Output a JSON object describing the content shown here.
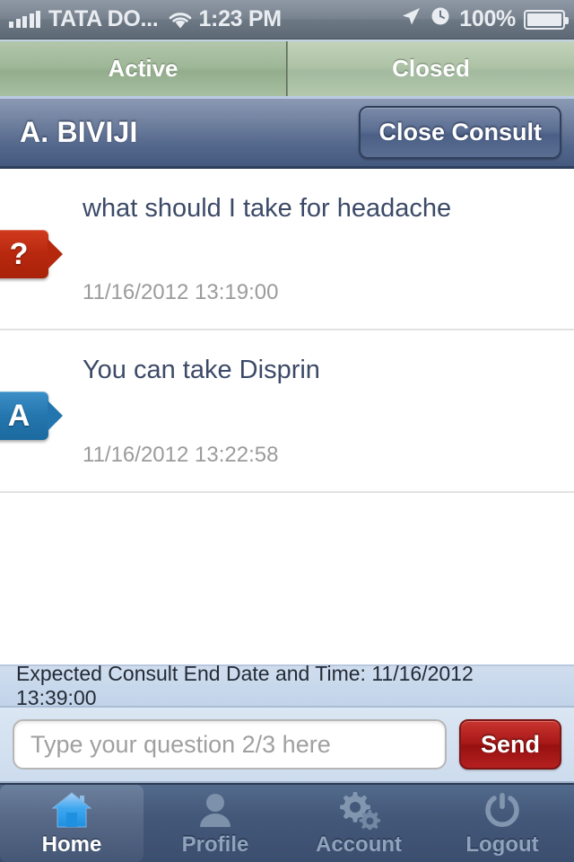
{
  "statusbar": {
    "signal_icon": "signal-bars-icon",
    "carrier": "TATA DO...",
    "wifi_icon": "wifi-icon",
    "time": "1:23 PM",
    "location_icon": "location-arrow-icon",
    "alarm_icon": "alarm-clock-icon",
    "battery_percent": "100%",
    "battery_icon": "battery-charging-icon"
  },
  "segmented": {
    "tabs": [
      {
        "label": "Active",
        "selected": true
      },
      {
        "label": "Closed",
        "selected": false
      }
    ]
  },
  "header": {
    "title": "A. BIVIJI",
    "close_button": "Close Consult"
  },
  "messages": [
    {
      "badge": "?",
      "badge_type": "question",
      "text": "what should I take for headache",
      "timestamp": "11/16/2012 13:19:00"
    },
    {
      "badge": "A",
      "badge_type": "answer",
      "text": "You can take Disprin",
      "timestamp": "11/16/2012 13:22:58"
    }
  ],
  "expected": {
    "text": "Expected Consult End Date and Time: 11/16/2012 13:39:00"
  },
  "composer": {
    "input_value": "",
    "input_placeholder": "Type your question 2/3 here",
    "send_label": "Send"
  },
  "tabbar": {
    "items": [
      {
        "label": "Home",
        "icon": "home-icon",
        "active": true
      },
      {
        "label": "Profile",
        "icon": "person-icon",
        "active": false
      },
      {
        "label": "Account",
        "icon": "gears-icon",
        "active": false
      },
      {
        "label": "Logout",
        "icon": "power-icon",
        "active": false
      }
    ]
  },
  "colors": {
    "question_red": "#b5280e",
    "answer_blue": "#2376ad",
    "header_blue": "#53678c",
    "tab_green": "#9fb898",
    "send_red": "#a81818"
  }
}
